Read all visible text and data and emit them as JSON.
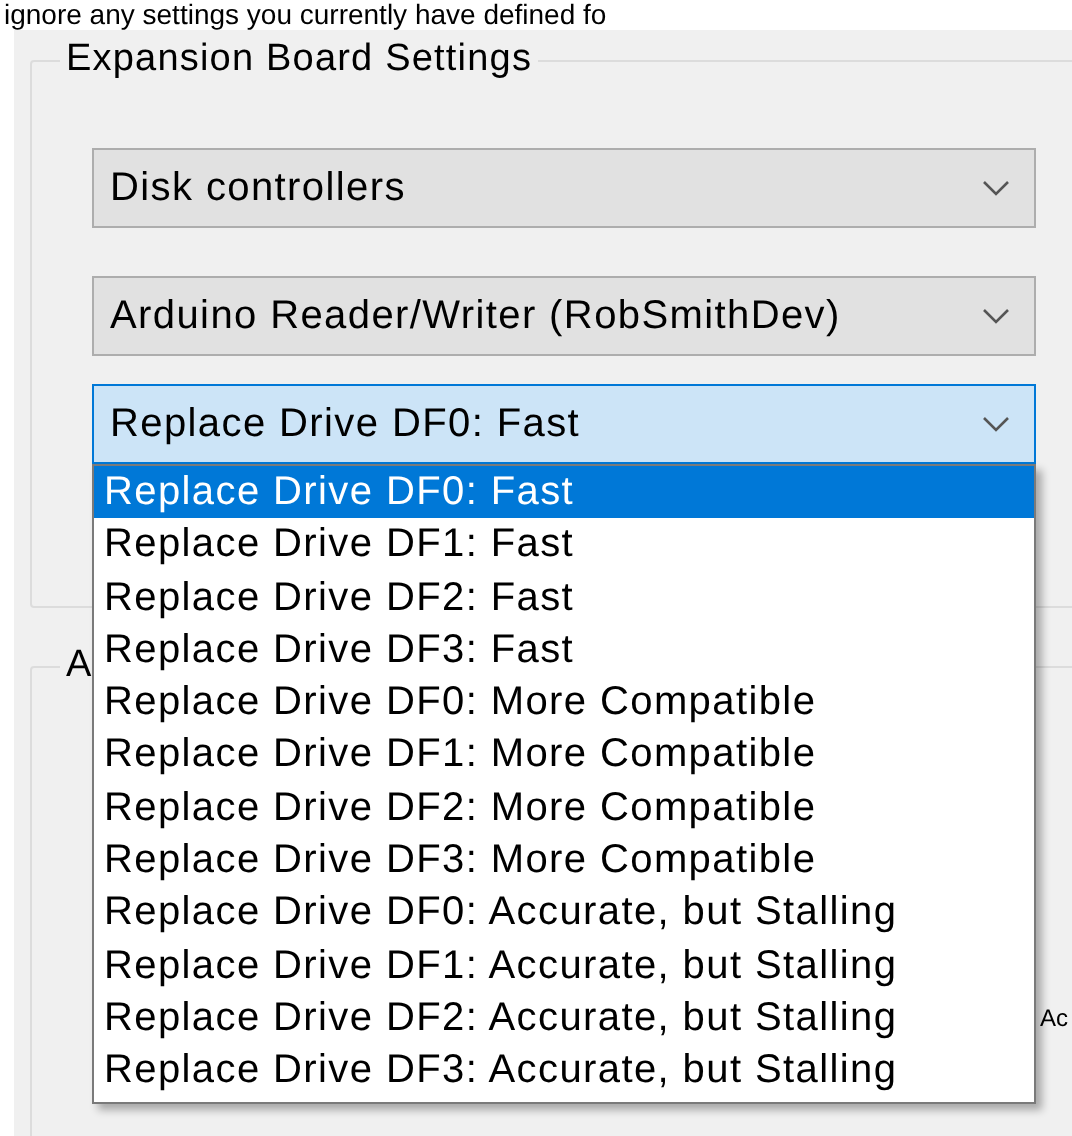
{
  "intro_text": "ignore any settings you currently have defined fo",
  "groups": [
    {
      "title": "Expansion Board Settings",
      "combos": [
        {
          "value": "Disk controllers",
          "expanded": false
        },
        {
          "value": "Arduino Reader/Writer (RobSmithDev)",
          "expanded": false
        },
        {
          "value": "Replace Drive DF0: Fast",
          "expanded": true,
          "options": [
            {
              "label": "Replace Drive DF0: Fast",
              "selected": true
            },
            {
              "label": "Replace Drive DF1: Fast",
              "selected": false
            },
            {
              "label": "Replace Drive DF2: Fast",
              "selected": false
            },
            {
              "label": "Replace Drive DF3: Fast",
              "selected": false
            },
            {
              "label": "Replace Drive DF0: More Compatible",
              "selected": false
            },
            {
              "label": "Replace Drive DF1: More Compatible",
              "selected": false
            },
            {
              "label": "Replace Drive DF2: More Compatible",
              "selected": false
            },
            {
              "label": "Replace Drive DF3: More Compatible",
              "selected": false
            },
            {
              "label": "Replace Drive DF0: Accurate, but Stalling",
              "selected": false
            },
            {
              "label": "Replace Drive DF1: Accurate, but Stalling",
              "selected": false
            },
            {
              "label": "Replace Drive DF2: Accurate, but Stalling",
              "selected": false
            },
            {
              "label": "Replace Drive DF3: Accurate, but Stalling",
              "selected": false
            }
          ]
        }
      ]
    },
    {
      "title": "A"
    }
  ],
  "side_label": "Ac"
}
